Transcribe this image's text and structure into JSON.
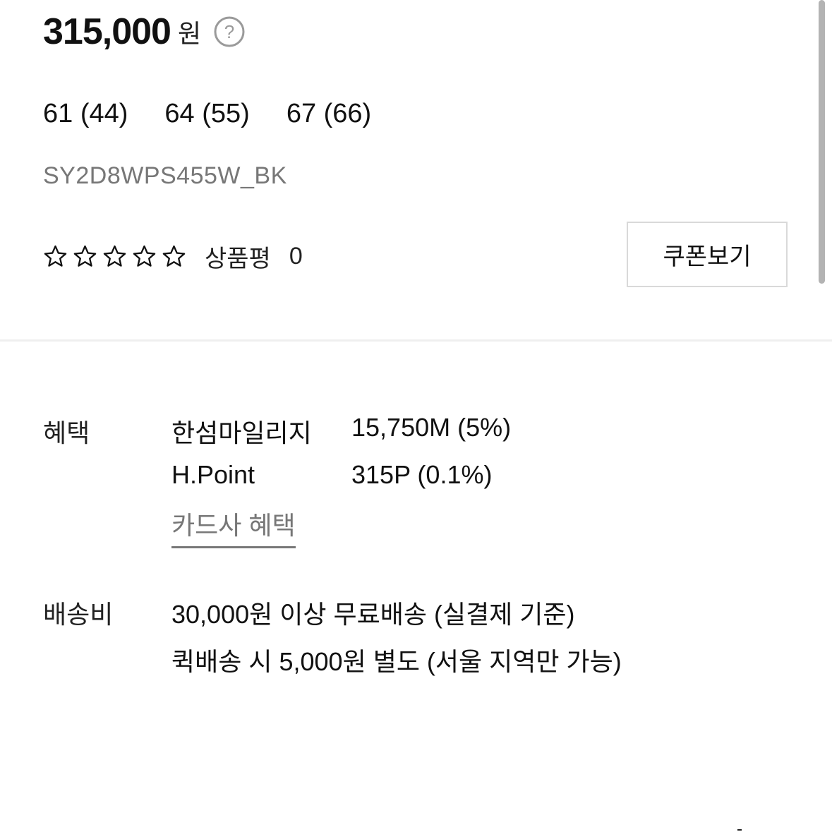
{
  "price": {
    "value": "315,000",
    "unit": "원",
    "help_icon": "question-circle-icon"
  },
  "sizes": [
    "61 (44)",
    "64 (55)",
    "67 (66)"
  ],
  "sku": "SY2D8WPS455W_BK",
  "rating": {
    "stars_filled": 0,
    "stars_total": 5,
    "star_icon": "star-outline-icon",
    "review_label": "상품평",
    "review_count": "0"
  },
  "coupon_button": "쿠폰보기",
  "benefits": {
    "label": "혜택",
    "items": [
      {
        "name": "한섬마일리지",
        "value": "15,750M (5%)"
      },
      {
        "name": "H.Point",
        "value": "315P (0.1%)"
      }
    ],
    "card_link": "카드사 혜택"
  },
  "shipping": {
    "label": "배송비",
    "lines": [
      "30,000원 이상 무료배송 (실결제 기준)",
      "퀵배송 시 5,000원 별도 (서울 지역만 가능)"
    ]
  },
  "colors": {
    "text": "#111111",
    "muted": "#777777",
    "border": "#d9d9d9",
    "divider": "#efefef"
  }
}
